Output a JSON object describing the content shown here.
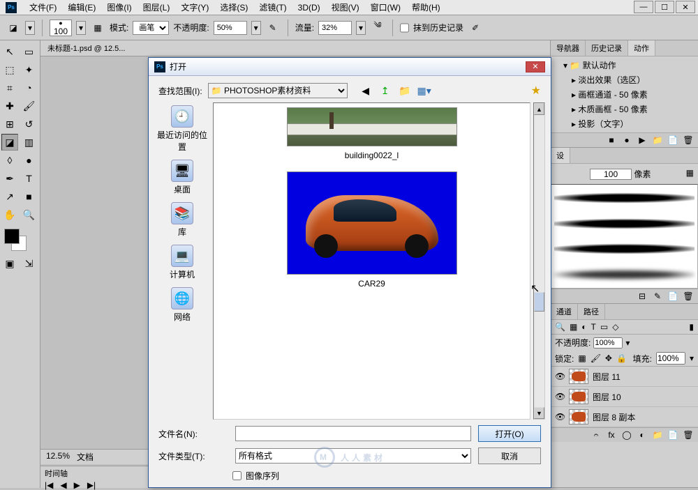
{
  "menubar": {
    "items": [
      "文件(F)",
      "编辑(E)",
      "图像(I)",
      "图层(L)",
      "文字(Y)",
      "选择(S)",
      "滤镜(T)",
      "3D(D)",
      "视图(V)",
      "窗口(W)",
      "帮助(H)"
    ]
  },
  "options_bar": {
    "brush_size": "100",
    "mode_label": "模式:",
    "mode_value": "画笔",
    "opacity_label": "不透明度:",
    "opacity_value": "50%",
    "flow_label": "流量:",
    "flow_value": "32%",
    "erase_history_label": "抹到历史记录"
  },
  "document": {
    "tab_title": "未标题-1.psd @ 12.5...",
    "zoom": "12.5%",
    "doc_label": "文档"
  },
  "timeline": {
    "title": "时间轴"
  },
  "panels": {
    "nav_tabs": [
      "导航器",
      "历史记录",
      "动作"
    ],
    "actions": {
      "default_set": "默认动作",
      "items": [
        "淡出效果（选区）",
        "画框通道 - 50 像素",
        "木质画框 - 50 像素",
        "投影（文字）"
      ]
    },
    "brushes": {
      "tab": "设",
      "size_value": "100",
      "size_unit": "像素"
    },
    "channels_tabs": [
      "通道",
      "路径"
    ],
    "layers": {
      "opacity_label": "不透明度:",
      "opacity_value": "100%",
      "lock_label": "锁定:",
      "fill_label": "填充:",
      "fill_value": "100%",
      "items": [
        {
          "name": "图层 11"
        },
        {
          "name": "图层 10"
        },
        {
          "name": "图层 8 副本"
        }
      ]
    }
  },
  "open_dialog": {
    "title": "打开",
    "lookin_label": "查找范围(I):",
    "lookin_value": "PHOTOSHOP素材资料",
    "places": [
      "最近访问的位置",
      "桌面",
      "库",
      "计算机",
      "网络"
    ],
    "files": [
      {
        "name": "building0022_l"
      },
      {
        "name": "CAR29"
      }
    ],
    "filename_label": "文件名(N):",
    "filename_value": "",
    "filetype_label": "文件类型(T):",
    "filetype_value": "所有格式",
    "open_btn": "打开(O)",
    "cancel_btn": "取消",
    "image_sequence_label": "图像序列"
  },
  "watermark": "人人素材"
}
